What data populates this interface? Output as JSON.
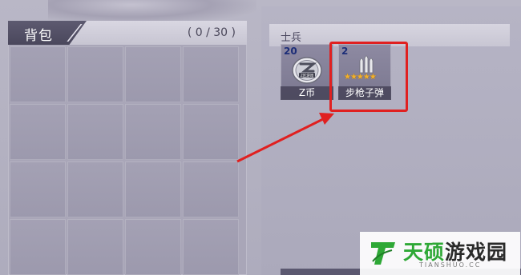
{
  "backpack": {
    "title": "背包",
    "count": "( 0 / 30 )",
    "slot_rows": 4,
    "slot_cols": 4
  },
  "soldier": {
    "title": "士兵",
    "items": [
      {
        "qty": "20",
        "name": "Z币",
        "icon": "z-coin-icon",
        "coin_label": "Z区游戏"
      },
      {
        "qty": "2",
        "name": "步枪子弹",
        "icon": "rifle-bullets-icon",
        "stars": 5
      }
    ]
  },
  "annotation": {
    "color": "#e02020"
  },
  "watermark": {
    "text": "天硕游戏园",
    "sub": "TIANSHUO.CC",
    "colors": {
      "green": "#2ea836",
      "dark": "#2a2a2a"
    }
  }
}
